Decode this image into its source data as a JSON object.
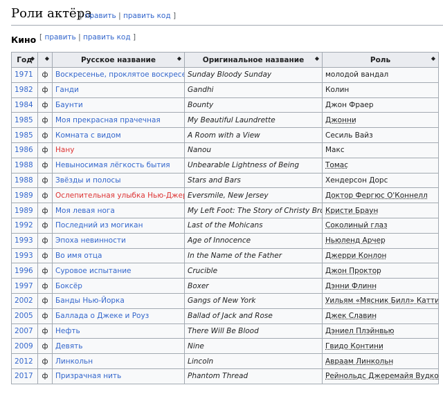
{
  "section": {
    "title": "Роли актёра",
    "edit_label": "править",
    "edit_code_label": "править код",
    "bracket_open": "[",
    "bracket_close": "]",
    "separator": "|"
  },
  "subsection": {
    "title": "Кино",
    "edit_label": "править",
    "edit_code_label": "править код",
    "bracket_open": "[",
    "bracket_close": "]",
    "separator": "|"
  },
  "table": {
    "columns": [
      "Год",
      "",
      "Русское название",
      "Оригинальное название",
      "Роль"
    ],
    "sort_icon": "◆",
    "rows": [
      {
        "year": "1971",
        "phi": "ф",
        "ru": "Воскресенье, проклятое воскресенье",
        "ru_missing": false,
        "orig": "Sunday Bloody Sunday",
        "role": "молодой вандал",
        "role_link": false
      },
      {
        "year": "1982",
        "phi": "ф",
        "ru": "Ганди",
        "ru_missing": false,
        "orig": "Gandhi",
        "role": "Колин",
        "role_link": false
      },
      {
        "year": "1984",
        "phi": "ф",
        "ru": "Баунти",
        "ru_missing": false,
        "orig": "Bounty",
        "role": "Джон Фраер",
        "role_link": false
      },
      {
        "year": "1985",
        "phi": "ф",
        "ru": "Моя прекрасная прачечная",
        "ru_missing": false,
        "orig": "My Beautiful Laundrette",
        "role": "Джонни",
        "role_link": true
      },
      {
        "year": "1985",
        "phi": "ф",
        "ru": "Комната с видом",
        "ru_missing": false,
        "orig": "A Room with a View",
        "role": "Сесиль Вайз",
        "role_link": false
      },
      {
        "year": "1986",
        "phi": "ф",
        "ru": "Нану",
        "ru_missing": true,
        "orig": "Nanou",
        "role": "Макс",
        "role_link": false
      },
      {
        "year": "1988",
        "phi": "ф",
        "ru": "Невыносимая лёгкость бытия",
        "ru_missing": false,
        "orig": "Unbearable Lightness of Being",
        "role": "Томас",
        "role_link": true
      },
      {
        "year": "1988",
        "phi": "ф",
        "ru": "Звёзды и полосы",
        "ru_missing": false,
        "orig": "Stars and Bars",
        "role": "Хендерсон Дорс",
        "role_link": false
      },
      {
        "year": "1989",
        "phi": "ф",
        "ru": "Ослепительная улыбка Нью-Джерси",
        "ru_missing": true,
        "orig": "Eversmile, New Jersey",
        "role": "Доктор Фергюс О'Коннелл",
        "role_link": true
      },
      {
        "year": "1989",
        "phi": "ф",
        "ru": "Моя левая нога",
        "ru_missing": false,
        "orig": "My Left Foot: The Story of Christy Brown",
        "role": "Кристи Браун",
        "role_link": true
      },
      {
        "year": "1992",
        "phi": "ф",
        "ru": "Последний из могикан",
        "ru_missing": false,
        "orig": "Last of the Mohicans",
        "role": "Соколиный глаз",
        "role_link": true
      },
      {
        "year": "1993",
        "phi": "ф",
        "ru": "Эпоха невинности",
        "ru_missing": false,
        "orig": "Age of Innocence",
        "role": "Ньюленд Арчер",
        "role_link": true
      },
      {
        "year": "1993",
        "phi": "ф",
        "ru": "Во имя отца",
        "ru_missing": false,
        "orig": "In the Name of the Father",
        "role": "Джерри Конлон",
        "role_link": true
      },
      {
        "year": "1996",
        "phi": "ф",
        "ru": "Суровое испытание",
        "ru_missing": false,
        "orig": "Crucible",
        "role": "Джон Проктор",
        "role_link": true
      },
      {
        "year": "1997",
        "phi": "ф",
        "ru": "Боксёр",
        "ru_missing": false,
        "orig": "Boxer",
        "role": "Дэнни Флинн",
        "role_link": true
      },
      {
        "year": "2002",
        "phi": "ф",
        "ru": "Банды Нью-Йорка",
        "ru_missing": false,
        "orig": "Gangs of New York",
        "role": "Уильям «Мясник Билл» Каттинг",
        "role_link": true
      },
      {
        "year": "2005",
        "phi": "ф",
        "ru": "Баллада о Джеке и Роуз",
        "ru_missing": false,
        "orig": "Ballad of Jack and Rose",
        "role": "Джек Славин",
        "role_link": true
      },
      {
        "year": "2007",
        "phi": "ф",
        "ru": "Нефть",
        "ru_missing": false,
        "orig": "There Will Be Blood",
        "role": "Дэниел Плэйнвью",
        "role_link": true
      },
      {
        "year": "2009",
        "phi": "ф",
        "ru": "Девять",
        "ru_missing": false,
        "orig": "Nine",
        "role": "Гвидо Контини",
        "role_link": true
      },
      {
        "year": "2012",
        "phi": "ф",
        "ru": "Линкольн",
        "ru_missing": false,
        "orig": "Lincoln",
        "role": "Авраам Линкольн",
        "role_link": true
      },
      {
        "year": "2017",
        "phi": "ф",
        "ru": "Призрачная нить",
        "ru_missing": false,
        "orig": "Phantom Thread",
        "role": "Рейнольдс Джеремайя Вудкок",
        "role_link": true
      }
    ]
  },
  "colors": {
    "link": "#3366cc",
    "missing_link": "#d33",
    "header_bg": "#eaecf0",
    "cell_bg": "#f8f9fa",
    "border": "#a2a9b1"
  }
}
